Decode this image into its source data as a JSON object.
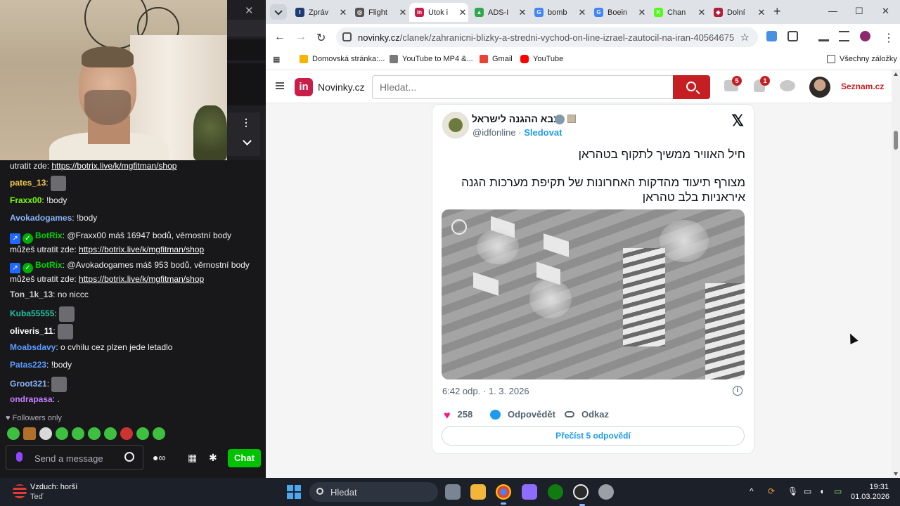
{
  "stream": {
    "chat": [
      {
        "id": "m1",
        "cont": true,
        "text": "utratit zde: ",
        "link": "https://botrix.live/k/mgfitman/shop"
      },
      {
        "id": "m2",
        "user": "pates_13",
        "color": "#f2c94c",
        "emote": "face-emote"
      },
      {
        "id": "m3",
        "user": "Fraxx00",
        "color": "#7cfc00",
        "text": "!body"
      },
      {
        "id": "m4",
        "user": "Avokadogames",
        "color": "#8ab4f8",
        "text": "!body"
      },
      {
        "id": "m5",
        "user": "BotRix",
        "color": "#00d100",
        "bot": true,
        "text": "@Fraxx00 máš 16947 bodů, věrnostní body můžeš utratit zde: ",
        "link": "https://botrix.live/k/mgfitman/shop"
      },
      {
        "id": "m6",
        "user": "BotRix",
        "color": "#00d100",
        "bot": true,
        "text": "@Avokadogames máš 953 bodů, věrnostní body můžeš utratit zde: ",
        "link": "https://botrix.live/k/mgfitman/shop"
      },
      {
        "id": "m7",
        "user": "Ton_1k_13",
        "color": "#d0d0d0",
        "text": "no niccc"
      },
      {
        "id": "m8",
        "user": "Kuba55555",
        "color": "#1ec3a4",
        "emote": "face-emote"
      },
      {
        "id": "m9",
        "user": "oliveris_11",
        "color": "#ffffff",
        "emote": "face-emote"
      },
      {
        "id": "m10",
        "user": "Moabsdavy",
        "color": "#5b9bff",
        "text": "o cvhilu cez plzen jede letadlo"
      },
      {
        "id": "m11",
        "user": "Patas223",
        "color": "#5b9bff",
        "text": "!body"
      },
      {
        "id": "m12",
        "user": "Groot321",
        "color": "#8ab4f8",
        "emote": "shark-emote"
      },
      {
        "id": "m13",
        "user": "ondrapasa",
        "color": "#c77dff",
        "text": "."
      }
    ],
    "followers_only": "Followers only",
    "input_placeholder": "Send a message",
    "chat_button": "Chat"
  },
  "browser": {
    "tabs": [
      {
        "label": "Zpráv",
        "fav_color": "#1f3b73",
        "fav_glyph": "I",
        "active": false
      },
      {
        "label": "Flight",
        "fav_color": "#555555",
        "fav_glyph": "◎",
        "active": false
      },
      {
        "label": "Útok i",
        "fav_color": "#c81e49",
        "fav_glyph": "in",
        "active": true
      },
      {
        "label": "ADS-I",
        "fav_color": "#2fa84f",
        "fav_glyph": "▲",
        "active": false
      },
      {
        "label": "bomb",
        "fav_color": "#4285f4",
        "fav_glyph": "G",
        "active": false
      },
      {
        "label": "Boein",
        "fav_color": "#4285f4",
        "fav_glyph": "G",
        "active": false
      },
      {
        "label": "Chan",
        "fav_color": "#53fc18",
        "fav_glyph": "K",
        "active": false
      },
      {
        "label": "Dolní",
        "fav_color": "#b01e3c",
        "fav_glyph": "◆",
        "active": false
      }
    ],
    "url_host": "novinky.cz",
    "url_path": "/clanek/zahranicni-blizky-a-stredni-vychod-on-line-izrael-zautocil-na-iran-40564675",
    "bookmarks": [
      "Domovská stránka:...",
      "YouTube to MP4 &...",
      "Gmail",
      "YouTube"
    ],
    "all_bookmarks": "Všechny záložky"
  },
  "site": {
    "name": "Novinky.cz",
    "logo_glyph": "in",
    "search_placeholder": "Hledat...",
    "mail_count": "5",
    "notif_count": "1",
    "seznam": "Seznam.cz"
  },
  "tweet": {
    "name": "צבא ההגנה לישראל",
    "handle": "@idfonline",
    "separator": "·",
    "follow": "Sledovat",
    "line1": "חיל האוויר ממשיך לתקוף בטהראן",
    "line2": "מצורף תיעוד מהדקות האחרונות של תקיפת מערכות הגנה איראניות בלב טהראן",
    "time": "6:42 odp. · 1. 3. 2026",
    "likes": "258",
    "reply": "Odpovědět",
    "link": "Odkaz",
    "read_replies": "Přečíst 5 odpovědí"
  },
  "taskbar": {
    "weather_line1": "Vzduch: horší",
    "weather_line2": "Teď",
    "search": "Hledat",
    "time": "19:31",
    "date": "01.03.2026"
  }
}
